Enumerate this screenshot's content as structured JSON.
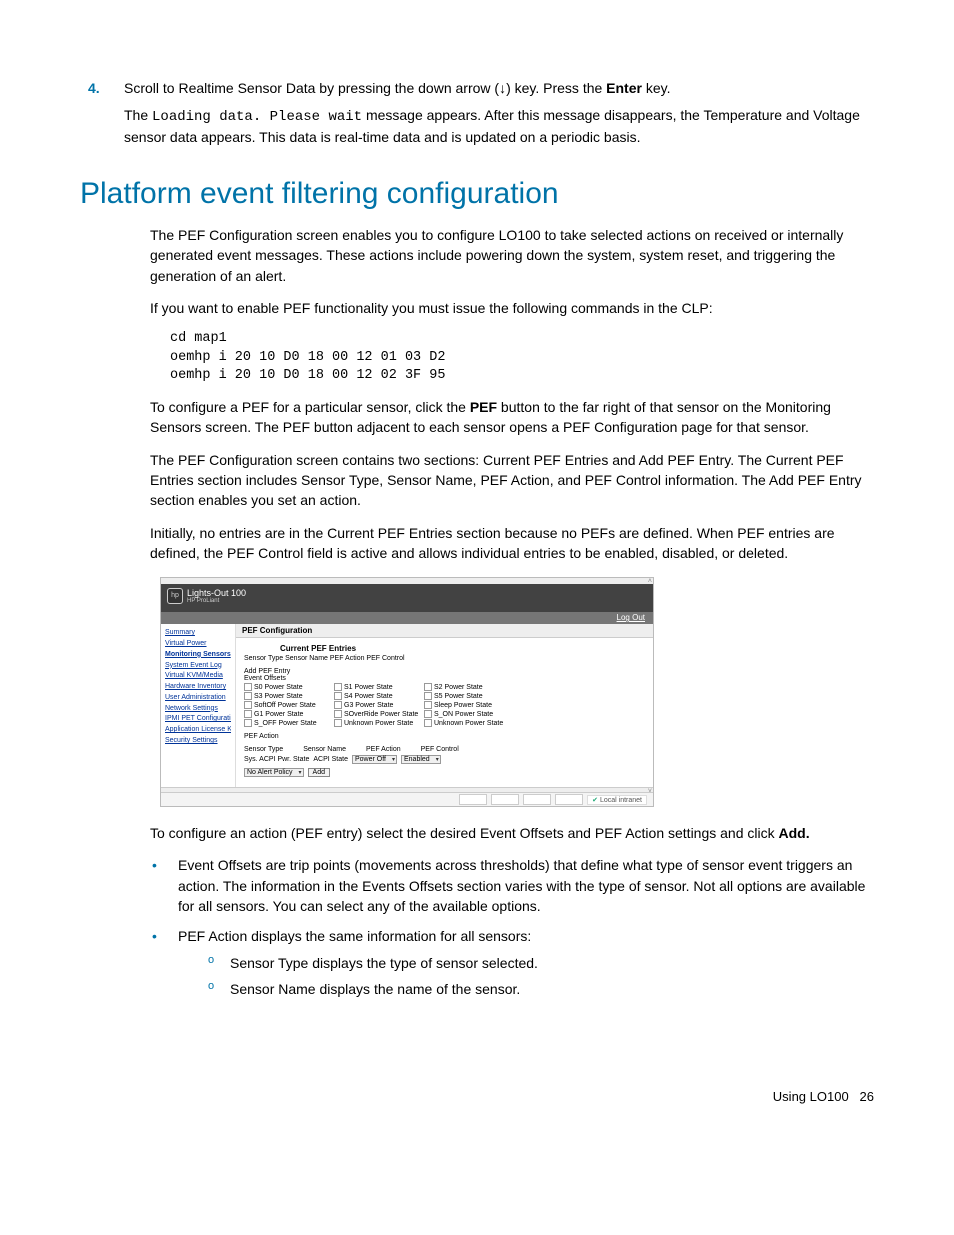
{
  "step": {
    "num": "4.",
    "line1_a": "Scroll to Realtime Sensor Data by pressing the down arrow (",
    "arrow": "↓",
    "line1_b": ") key. Press the ",
    "enter": "Enter",
    "line1_c": " key.",
    "para2_a": "The ",
    "para2_code": "Loading data. Please wait",
    "para2_b": " message appears. After this message disappears, the Temperature and Voltage sensor data appears. This data is real-time data and is updated on a periodic basis."
  },
  "heading": "Platform event filtering configuration",
  "p1": "The PEF Configuration screen enables you to configure LO100 to take selected actions on received or internally generated event messages. These actions include powering down the system, system reset, and triggering the generation of an alert.",
  "p2": "If you want to enable PEF functionality you must issue the following commands in the CLP:",
  "code": "cd map1\noemhp i 20 10 D0 18 00 12 01 03 D2\noemhp i 20 10 D0 18 00 12 02 3F 95",
  "p3_a": "To configure a PEF for a particular sensor, click the ",
  "p3_bold": "PEF",
  "p3_b": " button to the far right of that sensor on the Monitoring Sensors screen. The PEF button adjacent to each sensor opens a PEF Configuration page for that sensor.",
  "p4": "The PEF Configuration screen contains two sections: Current PEF Entries and Add PEF Entry. The Current PEF Entries section includes Sensor Type, Sensor Name, PEF Action, and PEF Control information. The Add PEF Entry section enables you set an action.",
  "p5": "Initially, no entries are in the Current PEF Entries section because no PEFs are defined. When PEF entries are defined, the PEF Control field is active and allows individual entries to be enabled, disabled, or deleted.",
  "figure": {
    "product": "Lights-Out 100",
    "subproduct": "HP ProLiant",
    "logout": "Log Out",
    "sidebar": [
      "Summary",
      "Virtual Power",
      "Monitoring Sensors",
      "System Event Log",
      "Virtual KVM/Media",
      "Hardware Inventory",
      "User Administration",
      "Network Settings",
      "IPMI PET Configuration",
      "Application License Key",
      "Security Settings"
    ],
    "pane_title": "PEF Configuration",
    "current_title": "Current PEF Entries",
    "table_headers": "Sensor Type Sensor Name PEF Action PEF Control",
    "add_title": "Add PEF Entry",
    "event_offsets_label": "Event Offsets",
    "offsets": [
      [
        "S0 Power State",
        "S1 Power State",
        "S2 Power State"
      ],
      [
        "S3 Power State",
        "S4 Power State",
        "S5 Power State"
      ],
      [
        "SoftOff Power State",
        "G3 Power State",
        "Sleep Power State"
      ],
      [
        "G1 Power State",
        "SOverRide Power State",
        "S_ON Power State"
      ],
      [
        "S_OFF Power State",
        "Unknown Power State",
        "Unknown Power State"
      ]
    ],
    "pef_action_label": "PEF Action",
    "row_labels": {
      "sensor_type": "Sensor Type",
      "sensor_name": "Sensor Name",
      "pef_action": "PEF Action",
      "pef_control": "PEF Control"
    },
    "form": {
      "sensor_type_val": "Sys. ACPI Pwr. State",
      "sensor_name_val": "ACPI State",
      "pef_action_sel": "Power Off",
      "pef_control_sel": "Enabled",
      "alert_policy_sel": "No Alert Policy",
      "add_btn": "Add"
    },
    "footer_zone": "Local intranet"
  },
  "p6_a": "To configure an action (PEF entry) select the desired Event Offsets and PEF Action settings and click ",
  "p6_bold": "Add.",
  "bullets": {
    "b1": "Event Offsets are trip points (movements across thresholds) that define what type of sensor event triggers an action. The information in the Events Offsets section varies with the type of sensor. Not all options are available for all sensors. You can select any of the available options.",
    "b2": "PEF Action displays the same information for all sensors:",
    "b2a": "Sensor Type displays the type of sensor selected.",
    "b2b": "Sensor Name displays the name of the sensor."
  },
  "footer": {
    "section": "Using LO100",
    "page": "26"
  }
}
